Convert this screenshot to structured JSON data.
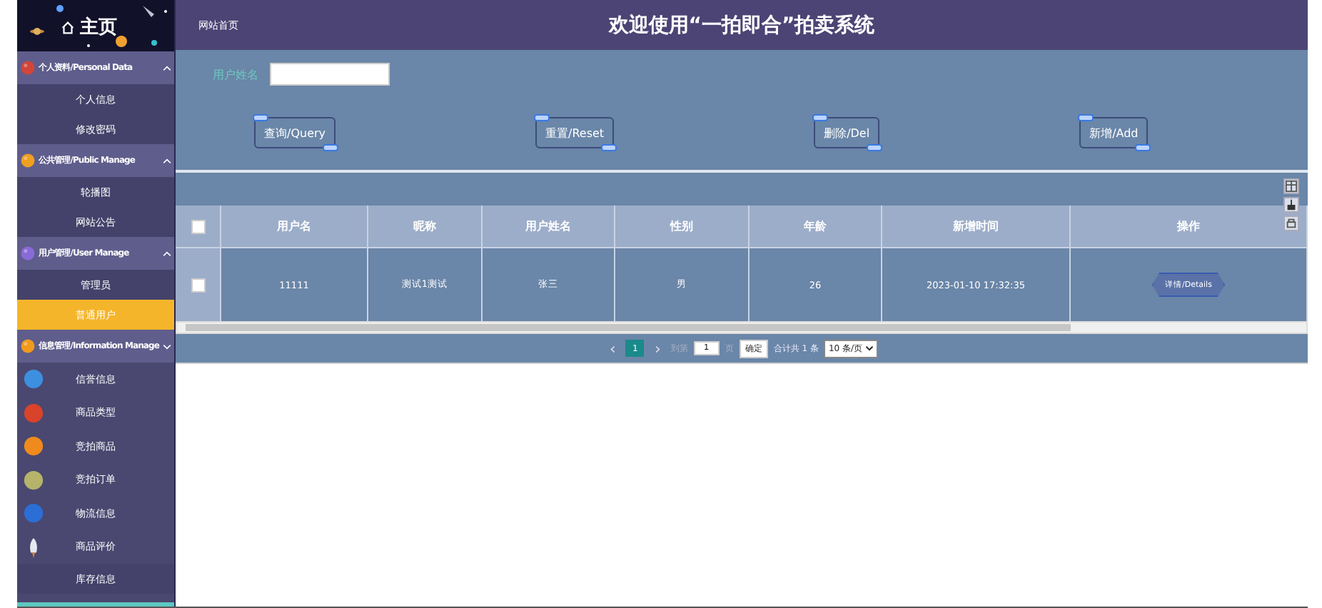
{
  "sidebar": {
    "home_label": "主页",
    "groups": [
      {
        "label": "个人资料/Personal Data",
        "color": "#d2453a",
        "expanded": true,
        "items": [
          {
            "label": "个人信息",
            "selected": false,
            "kind": "plain"
          },
          {
            "label": "修改密码",
            "selected": false,
            "kind": "plain"
          }
        ]
      },
      {
        "label": "公共管理/Public Manage",
        "color": "#f0a020",
        "expanded": true,
        "items": [
          {
            "label": "轮播图",
            "selected": false,
            "kind": "plain"
          },
          {
            "label": "网站公告",
            "selected": false,
            "kind": "plain"
          }
        ]
      },
      {
        "label": "用户管理/User Manage",
        "color": "#8a6ad8",
        "expanded": true,
        "items": [
          {
            "label": "管理员",
            "selected": false,
            "kind": "plain"
          },
          {
            "label": "普通用户",
            "selected": true,
            "kind": "plain"
          }
        ]
      },
      {
        "label": "信息管理/Information Manage",
        "color": "#f29a1e",
        "expanded": false,
        "items": [
          {
            "label": "信誉信息",
            "selected": false,
            "kind": "planet",
            "color": "#3d8fe0"
          },
          {
            "label": "商品类型",
            "selected": false,
            "kind": "planet",
            "color": "#d8432a"
          },
          {
            "label": "竞拍商品",
            "selected": false,
            "kind": "planet",
            "color": "#f08a1c"
          },
          {
            "label": "竞拍订单",
            "selected": false,
            "kind": "planet",
            "color": "#b5b46a"
          },
          {
            "label": "物流信息",
            "selected": false,
            "kind": "planet",
            "color": "#2b6fd6"
          },
          {
            "label": "商品评价",
            "selected": false,
            "kind": "rocket"
          },
          {
            "label": "库存信息",
            "selected": false,
            "kind": "plain"
          }
        ]
      }
    ]
  },
  "header": {
    "breadcrumb": "网站首页",
    "title": "欢迎使用“一拍即合”拍卖系统"
  },
  "search": {
    "label": "用户姓名"
  },
  "buttons": [
    "查询/Query",
    "重置/Reset",
    "删除/Del",
    "新增/Add"
  ],
  "table": {
    "select_all": false,
    "columns": [
      "用户名",
      "昵称",
      "用户姓名",
      "性别",
      "年龄",
      "新增时间",
      "操作"
    ],
    "rows": [
      {
        "checked": false,
        "cells": [
          "11111",
          "测试1测试",
          "张三",
          "男",
          "26",
          "2023-01-10 17:32:35"
        ],
        "action": "详情/Details"
      }
    ]
  },
  "pagination": {
    "prev": "‹",
    "pages": [
      {
        "label": "1",
        "selected": true
      }
    ],
    "next": "›",
    "goto_label": "到第",
    "goto_value": "1",
    "page_unit": "页",
    "confirm": "确定",
    "total": "合计共 1 条",
    "page_size": "10 条/页"
  }
}
